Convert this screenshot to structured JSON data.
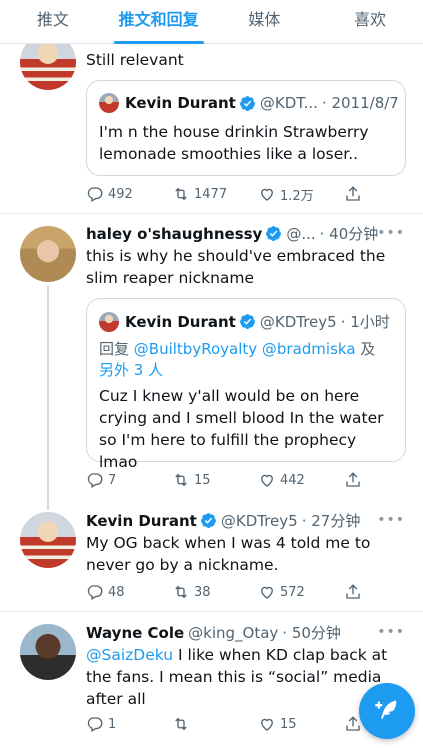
{
  "tabs": [
    {
      "label": "推文"
    },
    {
      "label": "推文和回复"
    },
    {
      "label": "媒体"
    },
    {
      "label": "喜欢"
    }
  ],
  "tweets": [
    {
      "text": "Still relevant",
      "quote": {
        "name": "Kevin Durant",
        "handle": "@KDT...",
        "time": "· 2011/8/7",
        "body": "I'm n the house drinkin Strawberry lemonade smoothies like a loser.."
      },
      "stats": {
        "replies": "492",
        "retweets": "1477",
        "likes": "1.2万"
      }
    },
    {
      "name": "haley o'shaughnessy",
      "handle": "@...",
      "time": "· 40分钟",
      "text": "this is why he should've embraced the slim reaper nickname",
      "quote": {
        "name": "Kevin Durant",
        "handle": "@KDTrey5",
        "time": "· 1小时",
        "reply_prefix": "回复",
        "reply_mentions": "@BuiltbyRoyalty @bradmiska",
        "reply_suffix": "及",
        "reply_others": "另外 3 人",
        "body": "Cuz I knew y'all would be on here crying and I smell blood In the water so I'm here to fulfill the prophecy lmao"
      },
      "stats": {
        "replies": "7",
        "retweets": "15",
        "likes": "442"
      }
    },
    {
      "name": "Kevin Durant",
      "handle": "@KDTrey5",
      "time": "· 27分钟",
      "text": "My OG back when I was 4 told me to never go by a nickname.",
      "stats": {
        "replies": "48",
        "retweets": "38",
        "likes": "572"
      }
    },
    {
      "name": "Wayne Cole",
      "handle": "@king_Otay",
      "time": "· 50分钟",
      "mention": "@SaizDeku",
      "text": " I like when KD clap back at the fans. I mean this is “social” media after all",
      "emoji": "🧘",
      "stats": {
        "replies": "1",
        "retweets": "",
        "likes": "15"
      }
    }
  ],
  "more_label": "•••",
  "colors": {
    "accent": "#1d9bf0",
    "text": "#0f1419",
    "muted": "#536471"
  }
}
